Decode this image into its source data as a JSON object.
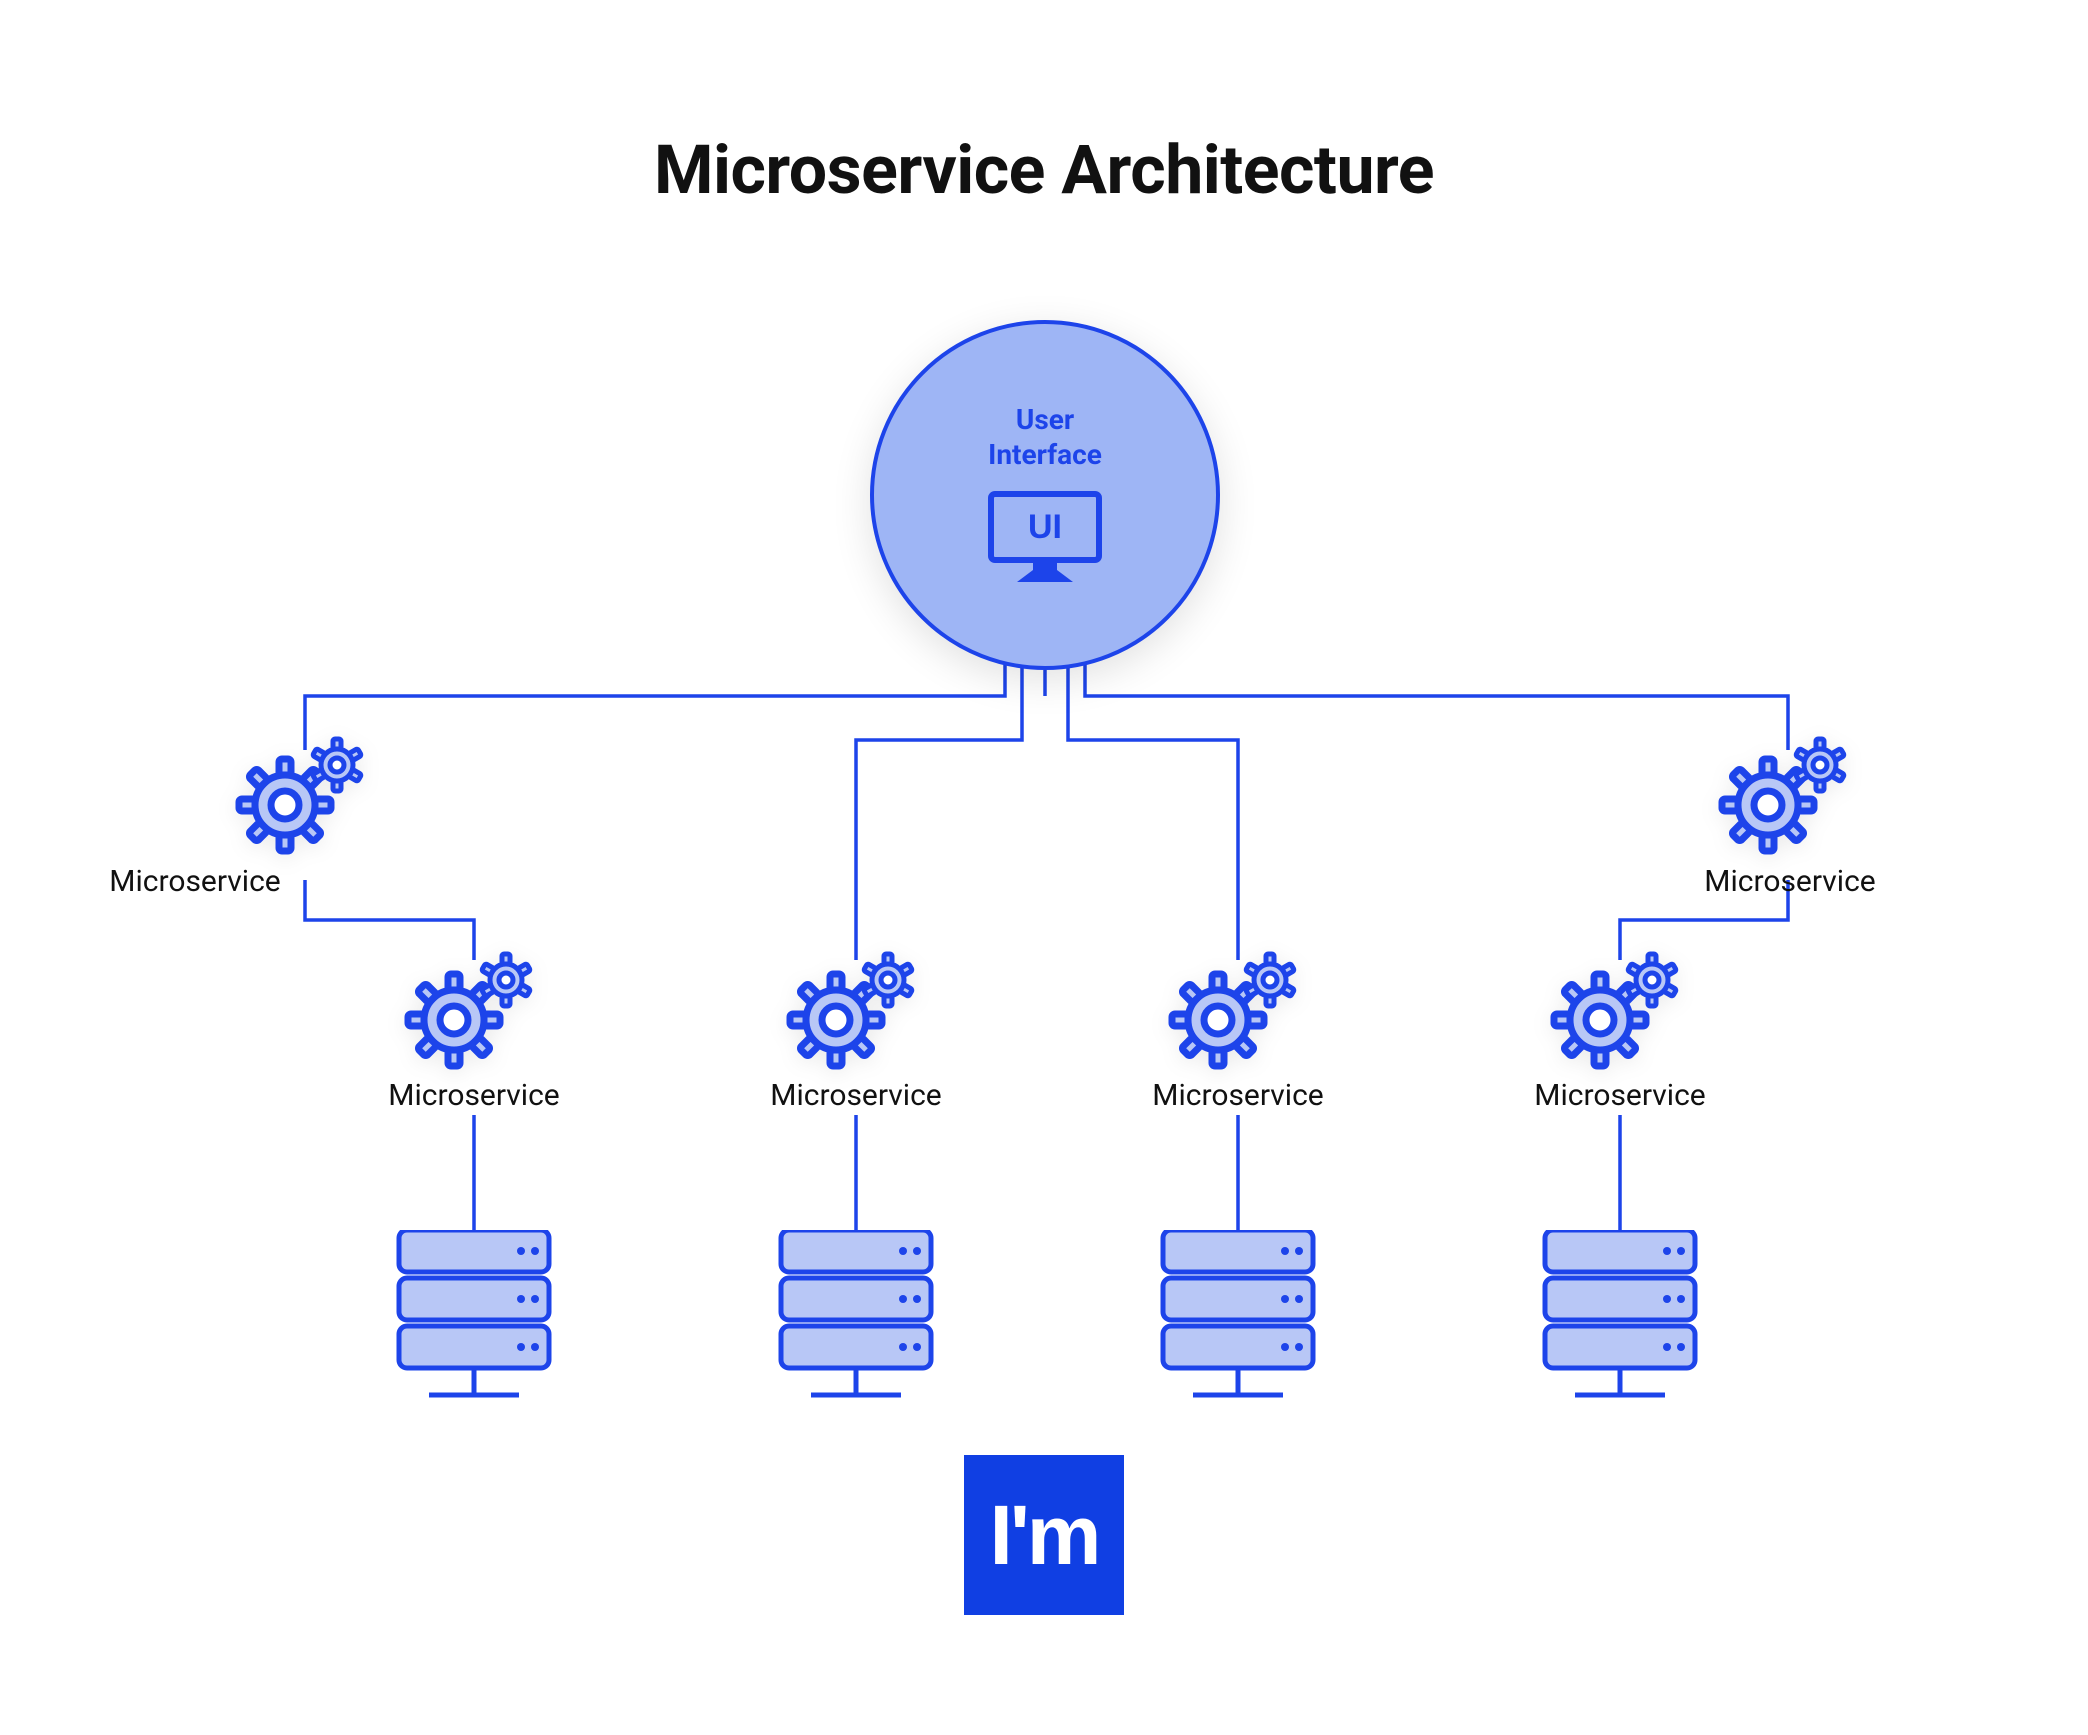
{
  "title": "Microservice Architecture",
  "ui_node": {
    "label_line1": "User",
    "label_line2": "Interface",
    "icon_text": "UI"
  },
  "microservices": {
    "top_left": {
      "label": "Microservice"
    },
    "top_right": {
      "label": "Microservice"
    },
    "bottom_row": [
      {
        "label": "Microservice"
      },
      {
        "label": "Microservice"
      },
      {
        "label": "Microservice"
      },
      {
        "label": "Microservice"
      }
    ]
  },
  "logo_text": "I'm",
  "colors": {
    "primary": "#1d44ea",
    "circle_fill": "#9eb5f5",
    "node_fill": "#b8c7f6",
    "text": "#111"
  }
}
